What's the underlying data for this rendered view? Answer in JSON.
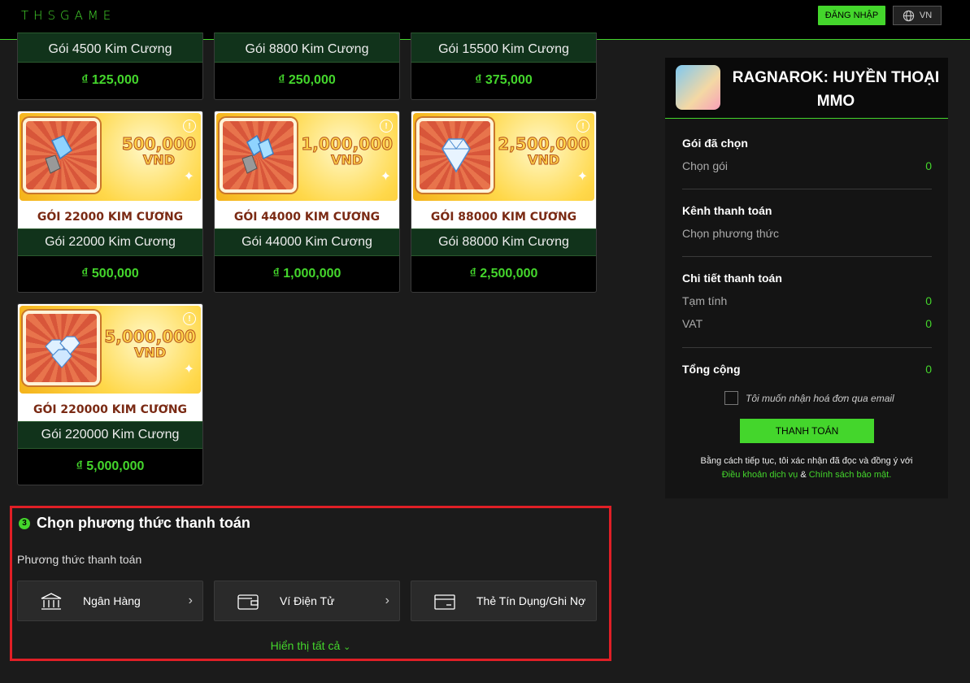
{
  "header": {
    "logo": "THSGAME",
    "login_label": "ĐĂNG NHẬP",
    "lang_label": "VN"
  },
  "top_cards": [
    {
      "name": "Gói 4500 Kim Cương",
      "price": "₫ 125,000"
    },
    {
      "name": "Gói 8800 Kim Cương",
      "price": "₫ 250,000"
    },
    {
      "name": "Gói 15500 Kim Cương",
      "price": "₫ 375,000"
    }
  ],
  "cards": [
    {
      "banner_amount": "500,000",
      "banner_currency": "VND",
      "banner_title": "GÓI 22000 KIM CƯƠNG",
      "name": "Gói 22000 Kim Cương",
      "price": "₫ 500,000"
    },
    {
      "banner_amount": "1,000,000",
      "banner_currency": "VND",
      "banner_title": "GÓI 44000 KIM CƯƠNG",
      "name": "Gói 44000 Kim Cương",
      "price": "₫ 1,000,000"
    },
    {
      "banner_amount": "2,500,000",
      "banner_currency": "VND",
      "banner_title": "GÓI 88000 KIM CƯƠNG",
      "name": "Gói 88000 Kim Cương",
      "price": "₫ 2,500,000"
    },
    {
      "banner_amount": "5,000,000",
      "banner_currency": "VND",
      "banner_title": "GÓI 220000 KIM CƯƠNG",
      "name": "Gói 220000 Kim Cương",
      "price": "₫ 5,000,000"
    }
  ],
  "payment": {
    "step_number": "3",
    "step_title": "Chọn phương thức thanh toán",
    "methods_label": "Phương thức thanh toán",
    "methods": [
      "Ngân Hàng",
      "Ví Điện Tử",
      "Thẻ Tín Dụng/Ghi Nợ"
    ],
    "show_all": "Hiển thị tất cả"
  },
  "summary": {
    "game_title": "RAGNAROK: HUYỀN THOẠI MMO",
    "selected_package_heading": "Gói đã chọn",
    "selected_package_label": "Chọn gói",
    "selected_package_value": "0",
    "channel_heading": "Kênh thanh toán",
    "channel_label": "Chọn phương thức",
    "details_heading": "Chi tiết thanh toán",
    "subtotal_label": "Tạm tính",
    "subtotal_value": "0",
    "vat_label": "VAT",
    "vat_value": "0",
    "total_label": "Tổng cộng",
    "total_value": "0",
    "email_invoice_label": "Tôi muốn nhận hoá đơn qua email",
    "pay_button": "THANH TOÁN",
    "terms_text": "Bằng cách tiếp tục, tôi xác nhận đã đọc và đồng ý với",
    "terms_link": "Điều khoản dịch vụ",
    "terms_and": "&",
    "privacy_link": "Chính sách bảo mật."
  },
  "colors": {
    "accent": "#44d62c",
    "highlight_border": "#e01f26",
    "background": "#1b1b1b"
  }
}
